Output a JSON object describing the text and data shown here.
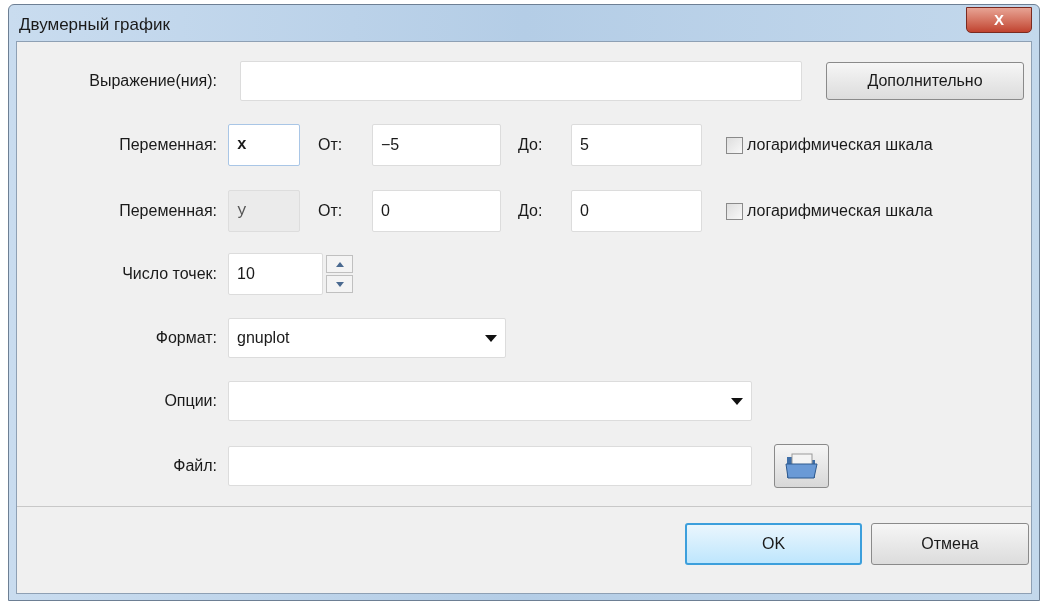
{
  "window": {
    "title": "Двумерный график",
    "close": "X"
  },
  "expression": {
    "label": "Выражение(ния):",
    "button": "Дополнительно"
  },
  "variables": [
    {
      "label": "Переменная:",
      "value": "x",
      "disabled": false,
      "from_label": "От:",
      "from": "−5",
      "to_label": "До:",
      "to": "5",
      "log_label": "логарифмическая шкала",
      "log_checked": false
    },
    {
      "label": "Переменная:",
      "value": "y",
      "disabled": true,
      "from_label": "От:",
      "from": "0",
      "to_label": "До:",
      "to": "0",
      "log_label": "логарифмическая шкала",
      "log_checked": false
    }
  ],
  "points": {
    "label": "Число точек:",
    "value": "10"
  },
  "format": {
    "label": "Формат:",
    "value": "gnuplot"
  },
  "options": {
    "label": "Опции:"
  },
  "file": {
    "label": "Файл:"
  },
  "buttons": [
    {
      "label": "OK",
      "default": true
    },
    {
      "label": "Отмена",
      "default": false
    }
  ]
}
